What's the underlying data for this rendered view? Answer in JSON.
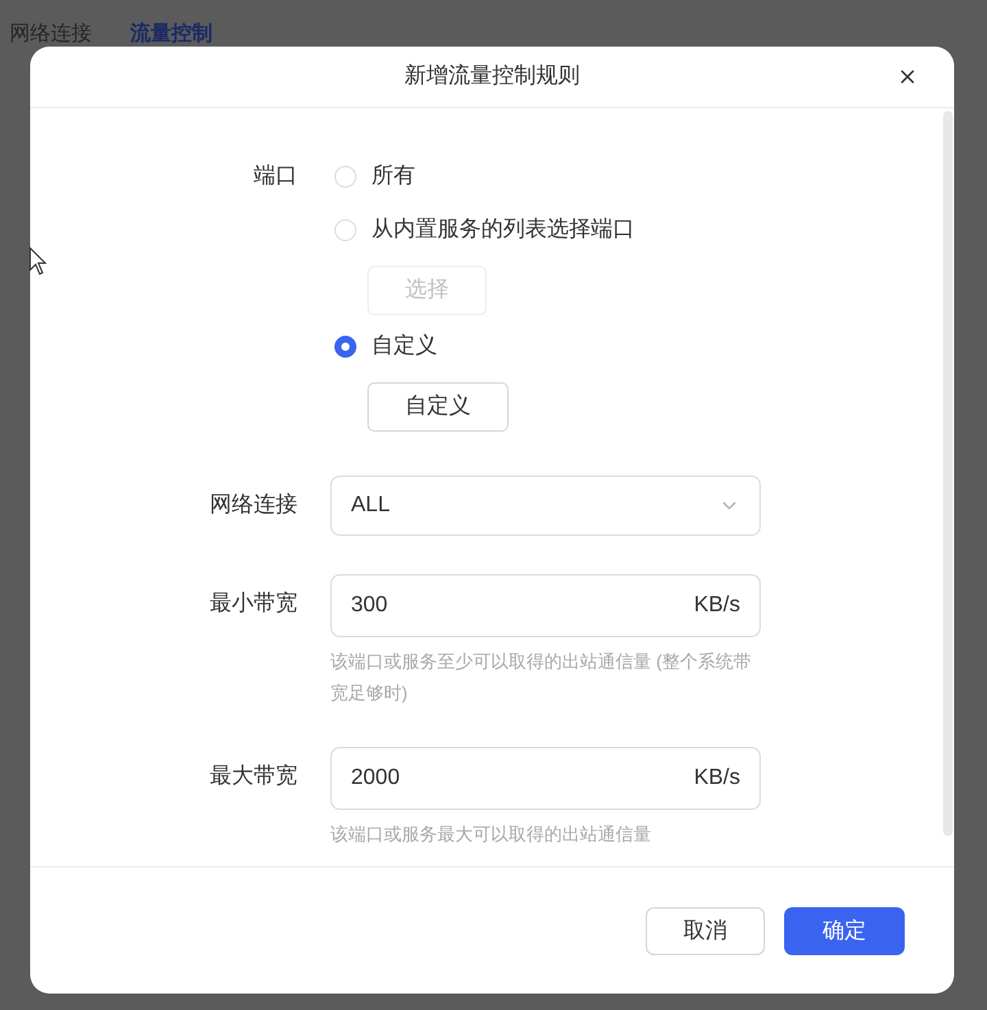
{
  "tabs": [
    {
      "label": "网络连接",
      "selected": false
    },
    {
      "label": "流量控制",
      "selected": true
    }
  ],
  "dialog": {
    "title": "新增流量控制规则"
  },
  "port": {
    "label": "端口",
    "options": [
      {
        "label": "所有",
        "selected": false
      },
      {
        "label": "从内置服务的列表选择端口",
        "selected": false,
        "button": {
          "label": "选择",
          "disabled": true
        }
      },
      {
        "label": "自定义",
        "selected": true,
        "button": {
          "label": "自定义",
          "disabled": false
        }
      }
    ]
  },
  "network": {
    "label": "网络连接",
    "value": "ALL"
  },
  "bandwidth": [
    {
      "label": "最小带宽",
      "value": "300",
      "unit": "KB/s",
      "help": "该端口或服务至少可以取得的出站通信量 (整个系统带宽足够时)"
    },
    {
      "label": "最大带宽",
      "value": "2000",
      "unit": "KB/s",
      "help": "该端口或服务最大可以取得的出站通信量"
    }
  ],
  "buttons": [
    {
      "label": "取消",
      "kind": "secondary"
    },
    {
      "label": "确定",
      "kind": "primary"
    }
  ]
}
